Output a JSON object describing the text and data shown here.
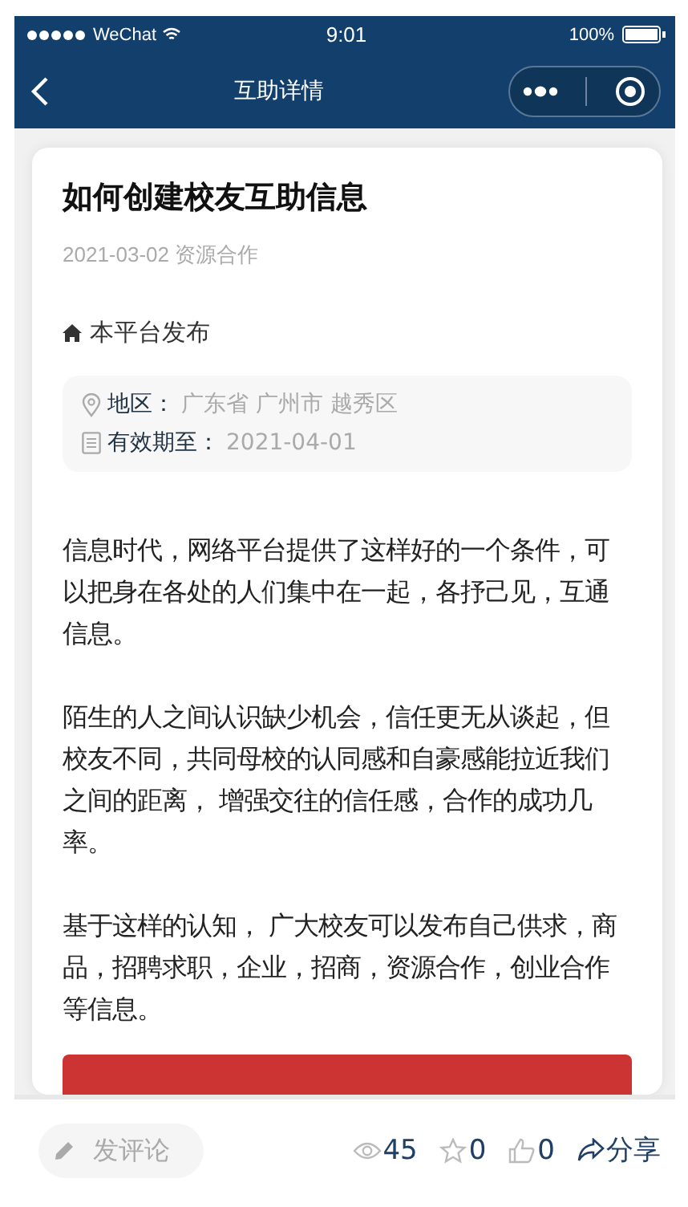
{
  "status_bar": {
    "carrier": "WeChat",
    "time": "9:01",
    "battery": "100%"
  },
  "nav": {
    "title": "互助详情"
  },
  "post": {
    "title": "如何创建校友互助信息",
    "meta": "2021-03-02 资源合作",
    "publisher": "本平台发布",
    "info": [
      {
        "kind": "location",
        "label": "地区：",
        "value": "广东省 广州市 越秀区"
      },
      {
        "kind": "expiry",
        "label": "有效期至：",
        "value": "2021-04-01"
      }
    ],
    "paragraphs": [
      "信息时代，网络平台提供了这样好的一个条件，可以把身在各处的人们集中在一起，各抒己见，互通信息。",
      "陌生的人之间认识缺少机会，信任更无从谈起，但校友不同，共同母校的认同感和自豪感能拉近我们之间的距离， 增强交往的信任感，合作的成功几率。",
      "基于这样的认知， 广大校友可以发布自己供求，商品，招聘求职，企业，招商，资源合作，创业合作等信息。"
    ]
  },
  "bottom_bar": {
    "comment_placeholder": "发评论",
    "stats": [
      {
        "kind": "views",
        "text": "45"
      },
      {
        "kind": "stars",
        "text": "0"
      },
      {
        "kind": "likes",
        "text": "0"
      },
      {
        "kind": "share",
        "text": "分享"
      }
    ]
  }
}
